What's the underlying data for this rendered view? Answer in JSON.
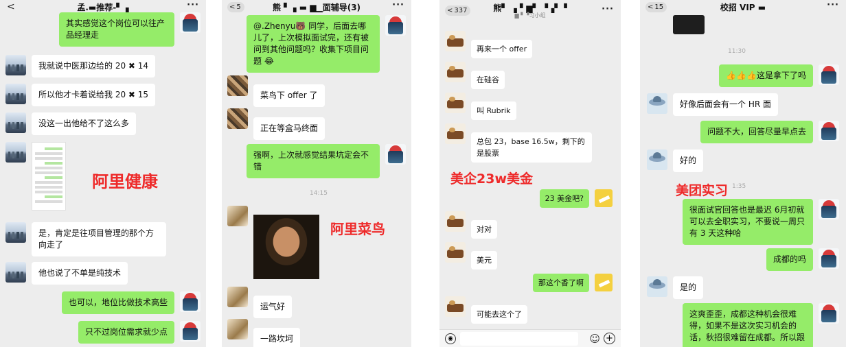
{
  "panel1": {
    "title": "孟.▬推荐-▘▗",
    "back": "<",
    "more": "···",
    "messages": [
      {
        "side": "right",
        "text": "其实感觉这个岗位可以往产品经理走"
      },
      {
        "side": "left",
        "text": "我就说中医那边给的 20 ✖ 14"
      },
      {
        "side": "left",
        "text": "所以他才卡着说给我 20 ✖ 15"
      },
      {
        "side": "left",
        "text": "没这一出他给不了这么多"
      },
      {
        "side": "left",
        "text": "是，肯定是往项目管理的那个方向走了"
      },
      {
        "side": "left",
        "text": "他也说了不单是纯技术"
      },
      {
        "side": "right",
        "text": "也可以，地位比做技术高些"
      },
      {
        "side": "right",
        "text": "只不过岗位需求就少点"
      }
    ],
    "overlay": "阿里健康"
  },
  "panel2": {
    "title": "熊 ▘▗ ▬ ▆▁面辅导(3)",
    "back_count": "5",
    "more": "···",
    "messages": [
      {
        "side": "right",
        "text": "@.Zhenyu🐻 同学，后面去哪儿了，上次模拟面试完，还有被问到其他问题吗？收集下项目问题 😂"
      },
      {
        "side": "left",
        "text": "菜鸟下 offer 了"
      },
      {
        "side": "left",
        "text": "正在等盒马终面"
      },
      {
        "side": "right",
        "text": "强啊，上次就感觉结果坑定会不错"
      },
      {
        "side": "left",
        "text": "运气好"
      },
      {
        "side": "left",
        "text": "一路坎坷"
      }
    ],
    "time": "14:15",
    "overlay": "阿里菜鸟"
  },
  "panel3": {
    "title": "熊▘ ▗ ▘▆▘ ▝▗▘▝",
    "subtitle": "▆ ▘▝习小组",
    "back_count": "337",
    "more": "···",
    "messages": [
      {
        "side": "left",
        "text": "再来一个 offer"
      },
      {
        "side": "left",
        "text": "在硅谷"
      },
      {
        "side": "left",
        "text": "叫 Rubrik"
      },
      {
        "side": "left",
        "text": "总包 23，base 16.5w，剩下的是股票"
      },
      {
        "side": "right",
        "text": "23 美金吧?"
      },
      {
        "side": "left",
        "text": "对对"
      },
      {
        "side": "left",
        "text": "美元"
      },
      {
        "side": "right",
        "text": "那这个香了啊"
      },
      {
        "side": "left",
        "text": "可能去这个了"
      }
    ],
    "overlay": "美企23w美金"
  },
  "panel4": {
    "title": "校招 VIP ▬",
    "back_count": "15",
    "more": "···",
    "messages": [
      {
        "side": "right",
        "text": "👍👍👍这是拿下了吗"
      },
      {
        "side": "left",
        "text": "好像后面会有一个 HR 面"
      },
      {
        "side": "right",
        "text": "问题不大，回答尽量早点去"
      },
      {
        "side": "left",
        "text": "好的"
      },
      {
        "side": "right",
        "text": "很面试官回答也是最迟 6月初就可以去全职实习，不要说一周只有 3 天这种哈"
      },
      {
        "side": "right",
        "text": "成都的吗"
      },
      {
        "side": "left",
        "text": "是的"
      },
      {
        "side": "right",
        "text": "这爽歪歪，成都这种机会很难得，如果不是这次实习机会的话，秋招很难留在成都。所以跟"
      }
    ],
    "time1": "11:30",
    "time2": "1:35",
    "overlay": "美团实习"
  }
}
